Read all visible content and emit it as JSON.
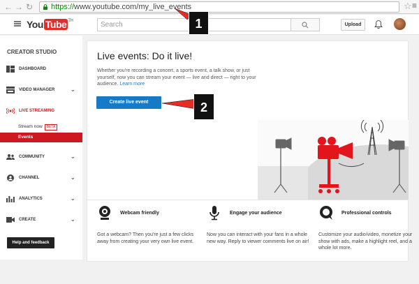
{
  "browser": {
    "url_scheme": "https://",
    "url_rest": "www.youtube.com/my_live_events",
    "star_icon": "star-icon",
    "menu_icon": "menu-icon"
  },
  "header": {
    "logo_you": "You",
    "logo_tube": "Tube",
    "logo_region": "TH",
    "search_placeholder": "Search",
    "upload_label": "Upload"
  },
  "sidebar": {
    "title": "CREATOR STUDIO",
    "items": [
      {
        "label": "DASHBOARD"
      },
      {
        "label": "VIDEO MANAGER"
      },
      {
        "label": "LIVE STREAMING"
      },
      {
        "label": "COMMUNITY"
      },
      {
        "label": "CHANNEL"
      },
      {
        "label": "ANALYTICS"
      },
      {
        "label": "CREATE"
      }
    ],
    "sub_stream_now": "Stream now",
    "sub_beta": "BETA",
    "sub_events": "Events",
    "help_label": "Help and feedback"
  },
  "main": {
    "title": "Live events: Do it live!",
    "description": "Whether you're recording a concert, a sports event, a talk show, or just yourself, now you can stream your event — live and direct — right to your audience.",
    "learn_more": "Learn more",
    "cta_label": "Create live event",
    "features": [
      {
        "title": "Webcam friendly",
        "text": "Got a webcam? Then you're just a few clicks away from creating your very own live event."
      },
      {
        "title": "Engage your audience",
        "text": "Now you can interact with your fans in a whole new way. Reply to viewer comments live on air!"
      },
      {
        "title": "Professional controls",
        "text": "Customize your audio/video, monetize your show with ads, make a highlight reel, and a whole lot more."
      }
    ]
  },
  "callouts": {
    "one": "1",
    "two": "2"
  },
  "colors": {
    "accent_red": "#cc181e",
    "button_blue": "#167ac6"
  }
}
